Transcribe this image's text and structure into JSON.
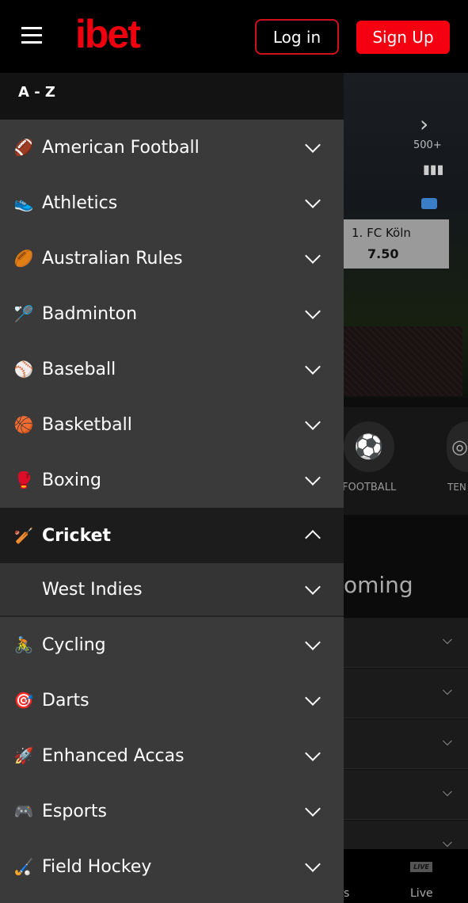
{
  "header": {
    "logo": "ibet",
    "login": "Log in",
    "signup": "Sign Up"
  },
  "drawer": {
    "title": "A - Z",
    "items_before": [
      {
        "label": "American Football",
        "icon": "american-football-icon",
        "glyph": "🏈"
      },
      {
        "label": "Athletics",
        "icon": "athletics-icon",
        "glyph": "👟"
      },
      {
        "label": "Australian Rules",
        "icon": "australian-rules-icon",
        "glyph": "🏉"
      },
      {
        "label": "Badminton",
        "icon": "badminton-icon",
        "glyph": "🏸"
      },
      {
        "label": "Baseball",
        "icon": "baseball-icon",
        "glyph": "⚾"
      },
      {
        "label": "Basketball",
        "icon": "basketball-icon",
        "glyph": "🏀"
      },
      {
        "label": "Boxing",
        "icon": "boxing-icon",
        "glyph": "🥊"
      }
    ],
    "open_item": {
      "label": "Cricket",
      "icon": "cricket-icon",
      "glyph": "🏏",
      "sub": [
        {
          "label": "West Indies"
        }
      ]
    },
    "items_after": [
      {
        "label": "Cycling",
        "icon": "cycling-icon",
        "glyph": "🚴"
      },
      {
        "label": "Darts",
        "icon": "darts-icon",
        "glyph": "🎯"
      },
      {
        "label": "Enhanced Accas",
        "icon": "enhanced-accas-icon",
        "glyph": "🚀"
      },
      {
        "label": "Esports",
        "icon": "esports-icon",
        "glyph": "🎮"
      },
      {
        "label": "Field Hockey",
        "icon": "field-hockey-icon",
        "glyph": "🏑"
      }
    ]
  },
  "background": {
    "markets_count": "500+",
    "odds_team": "1. FC Köln",
    "odds_value": "7.50",
    "sport1": "FOOTBALL",
    "sport2": "TEN",
    "upcoming": "oming",
    "live_badge": "LIVE",
    "nav_live": "Live",
    "nav_prev": "s"
  },
  "colors": {
    "brand": "#f50010",
    "drawer_bg": "#3a3a3a",
    "header_bg": "#000000"
  }
}
